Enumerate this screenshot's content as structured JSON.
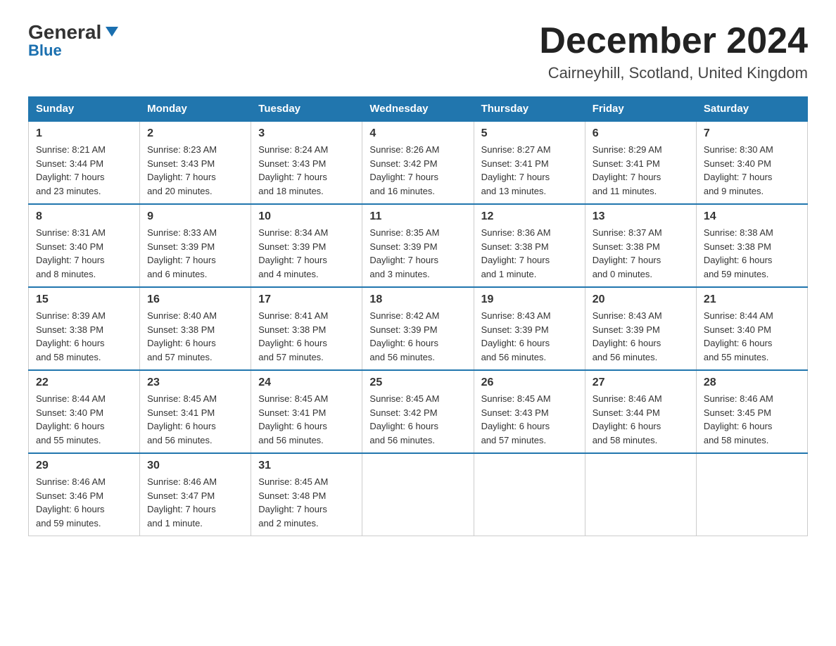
{
  "logo": {
    "general": "General",
    "blue": "Blue"
  },
  "header": {
    "title": "December 2024",
    "location": "Cairneyhill, Scotland, United Kingdom"
  },
  "days_of_week": [
    "Sunday",
    "Monday",
    "Tuesday",
    "Wednesday",
    "Thursday",
    "Friday",
    "Saturday"
  ],
  "weeks": [
    [
      {
        "day": "1",
        "sunrise": "Sunrise: 8:21 AM",
        "sunset": "Sunset: 3:44 PM",
        "daylight": "Daylight: 7 hours",
        "daylight2": "and 23 minutes."
      },
      {
        "day": "2",
        "sunrise": "Sunrise: 8:23 AM",
        "sunset": "Sunset: 3:43 PM",
        "daylight": "Daylight: 7 hours",
        "daylight2": "and 20 minutes."
      },
      {
        "day": "3",
        "sunrise": "Sunrise: 8:24 AM",
        "sunset": "Sunset: 3:43 PM",
        "daylight": "Daylight: 7 hours",
        "daylight2": "and 18 minutes."
      },
      {
        "day": "4",
        "sunrise": "Sunrise: 8:26 AM",
        "sunset": "Sunset: 3:42 PM",
        "daylight": "Daylight: 7 hours",
        "daylight2": "and 16 minutes."
      },
      {
        "day": "5",
        "sunrise": "Sunrise: 8:27 AM",
        "sunset": "Sunset: 3:41 PM",
        "daylight": "Daylight: 7 hours",
        "daylight2": "and 13 minutes."
      },
      {
        "day": "6",
        "sunrise": "Sunrise: 8:29 AM",
        "sunset": "Sunset: 3:41 PM",
        "daylight": "Daylight: 7 hours",
        "daylight2": "and 11 minutes."
      },
      {
        "day": "7",
        "sunrise": "Sunrise: 8:30 AM",
        "sunset": "Sunset: 3:40 PM",
        "daylight": "Daylight: 7 hours",
        "daylight2": "and 9 minutes."
      }
    ],
    [
      {
        "day": "8",
        "sunrise": "Sunrise: 8:31 AM",
        "sunset": "Sunset: 3:40 PM",
        "daylight": "Daylight: 7 hours",
        "daylight2": "and 8 minutes."
      },
      {
        "day": "9",
        "sunrise": "Sunrise: 8:33 AM",
        "sunset": "Sunset: 3:39 PM",
        "daylight": "Daylight: 7 hours",
        "daylight2": "and 6 minutes."
      },
      {
        "day": "10",
        "sunrise": "Sunrise: 8:34 AM",
        "sunset": "Sunset: 3:39 PM",
        "daylight": "Daylight: 7 hours",
        "daylight2": "and 4 minutes."
      },
      {
        "day": "11",
        "sunrise": "Sunrise: 8:35 AM",
        "sunset": "Sunset: 3:39 PM",
        "daylight": "Daylight: 7 hours",
        "daylight2": "and 3 minutes."
      },
      {
        "day": "12",
        "sunrise": "Sunrise: 8:36 AM",
        "sunset": "Sunset: 3:38 PM",
        "daylight": "Daylight: 7 hours",
        "daylight2": "and 1 minute."
      },
      {
        "day": "13",
        "sunrise": "Sunrise: 8:37 AM",
        "sunset": "Sunset: 3:38 PM",
        "daylight": "Daylight: 7 hours",
        "daylight2": "and 0 minutes."
      },
      {
        "day": "14",
        "sunrise": "Sunrise: 8:38 AM",
        "sunset": "Sunset: 3:38 PM",
        "daylight": "Daylight: 6 hours",
        "daylight2": "and 59 minutes."
      }
    ],
    [
      {
        "day": "15",
        "sunrise": "Sunrise: 8:39 AM",
        "sunset": "Sunset: 3:38 PM",
        "daylight": "Daylight: 6 hours",
        "daylight2": "and 58 minutes."
      },
      {
        "day": "16",
        "sunrise": "Sunrise: 8:40 AM",
        "sunset": "Sunset: 3:38 PM",
        "daylight": "Daylight: 6 hours",
        "daylight2": "and 57 minutes."
      },
      {
        "day": "17",
        "sunrise": "Sunrise: 8:41 AM",
        "sunset": "Sunset: 3:38 PM",
        "daylight": "Daylight: 6 hours",
        "daylight2": "and 57 minutes."
      },
      {
        "day": "18",
        "sunrise": "Sunrise: 8:42 AM",
        "sunset": "Sunset: 3:39 PM",
        "daylight": "Daylight: 6 hours",
        "daylight2": "and 56 minutes."
      },
      {
        "day": "19",
        "sunrise": "Sunrise: 8:43 AM",
        "sunset": "Sunset: 3:39 PM",
        "daylight": "Daylight: 6 hours",
        "daylight2": "and 56 minutes."
      },
      {
        "day": "20",
        "sunrise": "Sunrise: 8:43 AM",
        "sunset": "Sunset: 3:39 PM",
        "daylight": "Daylight: 6 hours",
        "daylight2": "and 56 minutes."
      },
      {
        "day": "21",
        "sunrise": "Sunrise: 8:44 AM",
        "sunset": "Sunset: 3:40 PM",
        "daylight": "Daylight: 6 hours",
        "daylight2": "and 55 minutes."
      }
    ],
    [
      {
        "day": "22",
        "sunrise": "Sunrise: 8:44 AM",
        "sunset": "Sunset: 3:40 PM",
        "daylight": "Daylight: 6 hours",
        "daylight2": "and 55 minutes."
      },
      {
        "day": "23",
        "sunrise": "Sunrise: 8:45 AM",
        "sunset": "Sunset: 3:41 PM",
        "daylight": "Daylight: 6 hours",
        "daylight2": "and 56 minutes."
      },
      {
        "day": "24",
        "sunrise": "Sunrise: 8:45 AM",
        "sunset": "Sunset: 3:41 PM",
        "daylight": "Daylight: 6 hours",
        "daylight2": "and 56 minutes."
      },
      {
        "day": "25",
        "sunrise": "Sunrise: 8:45 AM",
        "sunset": "Sunset: 3:42 PM",
        "daylight": "Daylight: 6 hours",
        "daylight2": "and 56 minutes."
      },
      {
        "day": "26",
        "sunrise": "Sunrise: 8:45 AM",
        "sunset": "Sunset: 3:43 PM",
        "daylight": "Daylight: 6 hours",
        "daylight2": "and 57 minutes."
      },
      {
        "day": "27",
        "sunrise": "Sunrise: 8:46 AM",
        "sunset": "Sunset: 3:44 PM",
        "daylight": "Daylight: 6 hours",
        "daylight2": "and 58 minutes."
      },
      {
        "day": "28",
        "sunrise": "Sunrise: 8:46 AM",
        "sunset": "Sunset: 3:45 PM",
        "daylight": "Daylight: 6 hours",
        "daylight2": "and 58 minutes."
      }
    ],
    [
      {
        "day": "29",
        "sunrise": "Sunrise: 8:46 AM",
        "sunset": "Sunset: 3:46 PM",
        "daylight": "Daylight: 6 hours",
        "daylight2": "and 59 minutes."
      },
      {
        "day": "30",
        "sunrise": "Sunrise: 8:46 AM",
        "sunset": "Sunset: 3:47 PM",
        "daylight": "Daylight: 7 hours",
        "daylight2": "and 1 minute."
      },
      {
        "day": "31",
        "sunrise": "Sunrise: 8:45 AM",
        "sunset": "Sunset: 3:48 PM",
        "daylight": "Daylight: 7 hours",
        "daylight2": "and 2 minutes."
      },
      null,
      null,
      null,
      null
    ]
  ]
}
